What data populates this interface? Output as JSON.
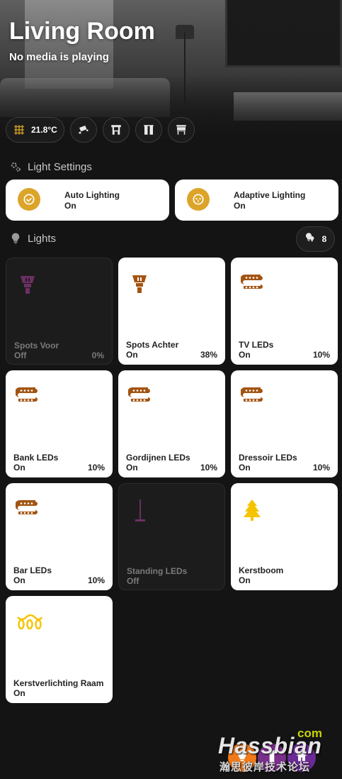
{
  "header": {
    "title": "Living Room",
    "subtitle": "No media is playing"
  },
  "chips": [
    {
      "icon": "radiator-icon",
      "label": "21.8°C"
    },
    {
      "icon": "security-camera-icon"
    },
    {
      "icon": "fireplace-icon"
    },
    {
      "icon": "curtains-icon"
    },
    {
      "icon": "window-shutter-icon"
    }
  ],
  "light_settings": {
    "heading": "Light Settings",
    "cards": [
      {
        "name": "Auto Lighting",
        "state": "On",
        "icon": "check-circle-icon"
      },
      {
        "name": "Adaptive Lighting",
        "state": "On",
        "icon": "adaptive-lighting-icon"
      }
    ]
  },
  "lights": {
    "heading": "Lights",
    "count": "8",
    "tiles": [
      {
        "name": "Spots Voor",
        "state": "Off",
        "pct": "0%",
        "icon": "spotlight-bulb-icon",
        "on": false
      },
      {
        "name": "Spots Achter",
        "state": "On",
        "pct": "38%",
        "icon": "spotlight-bulb-icon",
        "on": true
      },
      {
        "name": "TV LEDs",
        "state": "On",
        "pct": "10%",
        "icon": "led-strip-icon",
        "on": true
      },
      {
        "name": "Bank LEDs",
        "state": "On",
        "pct": "10%",
        "icon": "led-strip-icon",
        "on": true
      },
      {
        "name": "Gordijnen LEDs",
        "state": "On",
        "pct": "10%",
        "icon": "led-strip-icon",
        "on": true
      },
      {
        "name": "Dressoir LEDs",
        "state": "On",
        "pct": "10%",
        "icon": "led-strip-icon",
        "on": true
      },
      {
        "name": "Bar LEDs",
        "state": "On",
        "pct": "10%",
        "icon": "led-strip-icon",
        "on": true
      },
      {
        "name": "Standing LEDs",
        "state": "Off",
        "pct": "",
        "icon": "floor-lamp-icon",
        "on": false
      },
      {
        "name": "Kerstboom",
        "state": "On",
        "pct": "",
        "icon": "pine-tree-icon",
        "on": true
      },
      {
        "name": "Kerstverlichting Raam",
        "state": "On",
        "pct": "",
        "icon": "string-lights-icon",
        "on": true
      }
    ]
  },
  "watermark": {
    "com": "com",
    "main": "Hassbian",
    "sub": "瀚思彼岸技术论坛"
  },
  "colors": {
    "accent_gold": "#dca52a",
    "icon_brown": "#a35412",
    "icon_off_purple": "#6b2f63",
    "tree_yellow": "#f5c400",
    "background": "#141414"
  }
}
